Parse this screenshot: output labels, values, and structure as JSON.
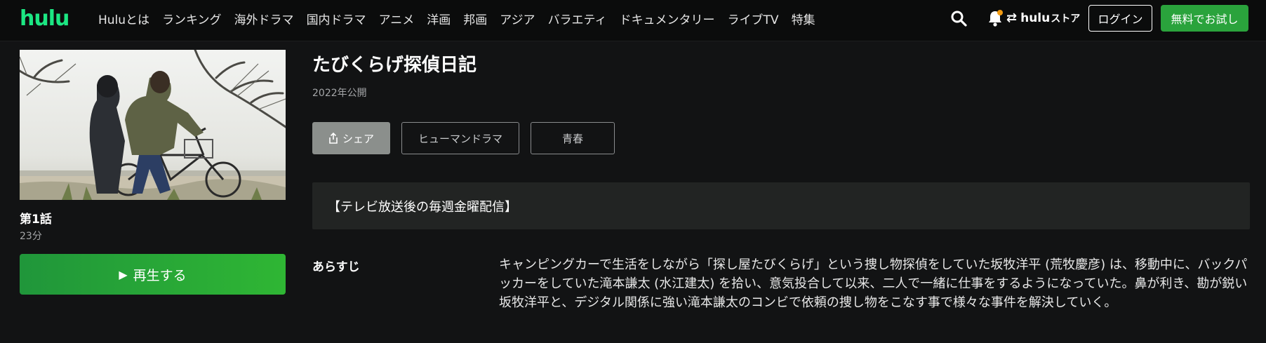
{
  "header": {
    "logo": "hulu",
    "nav": [
      "Huluとは",
      "ランキング",
      "海外ドラマ",
      "国内ドラマ",
      "アニメ",
      "洋画",
      "邦画",
      "アジア",
      "バラエティ",
      "ドキュメンタリー",
      "ライブTV",
      "特集"
    ],
    "store": {
      "brand": "hulu",
      "suffix": "ストア"
    },
    "login_label": "ログイン",
    "trial_label": "無料でお試し",
    "icons": [
      "search-icon",
      "bell-icon",
      "swap-icon"
    ],
    "notification_dot_color": "#f39c12"
  },
  "episode": {
    "title": "第1話",
    "duration": "23分",
    "play_label": "再生する"
  },
  "show": {
    "title": "たびくらげ探偵日記",
    "year": "2022年公開",
    "share_label": "シェア",
    "genres": [
      "ヒューマンドラマ",
      "青春"
    ],
    "notice": "【テレビ放送後の毎週金曜配信】",
    "synopsis_label": "あらすじ",
    "synopsis": "キャンピングカーで生活をしながら「探し屋たびくらげ」という捜し物探偵をしていた坂牧洋平 (荒牧慶彦) は、移動中に、バックパッカーをしていた滝本謙太 (水江建太) を拾い、意気投合して以来、二人で一緒に仕事をするようになっていた。鼻が利き、勘が鋭い坂牧洋平と、デジタル関係に強い滝本謙太のコンビで依頼の捜し物をこなす事で様々な事件を解決していく。"
  },
  "colors": {
    "brand_green": "#1ce783",
    "button_green": "#2aa33c",
    "background": "#121314"
  }
}
